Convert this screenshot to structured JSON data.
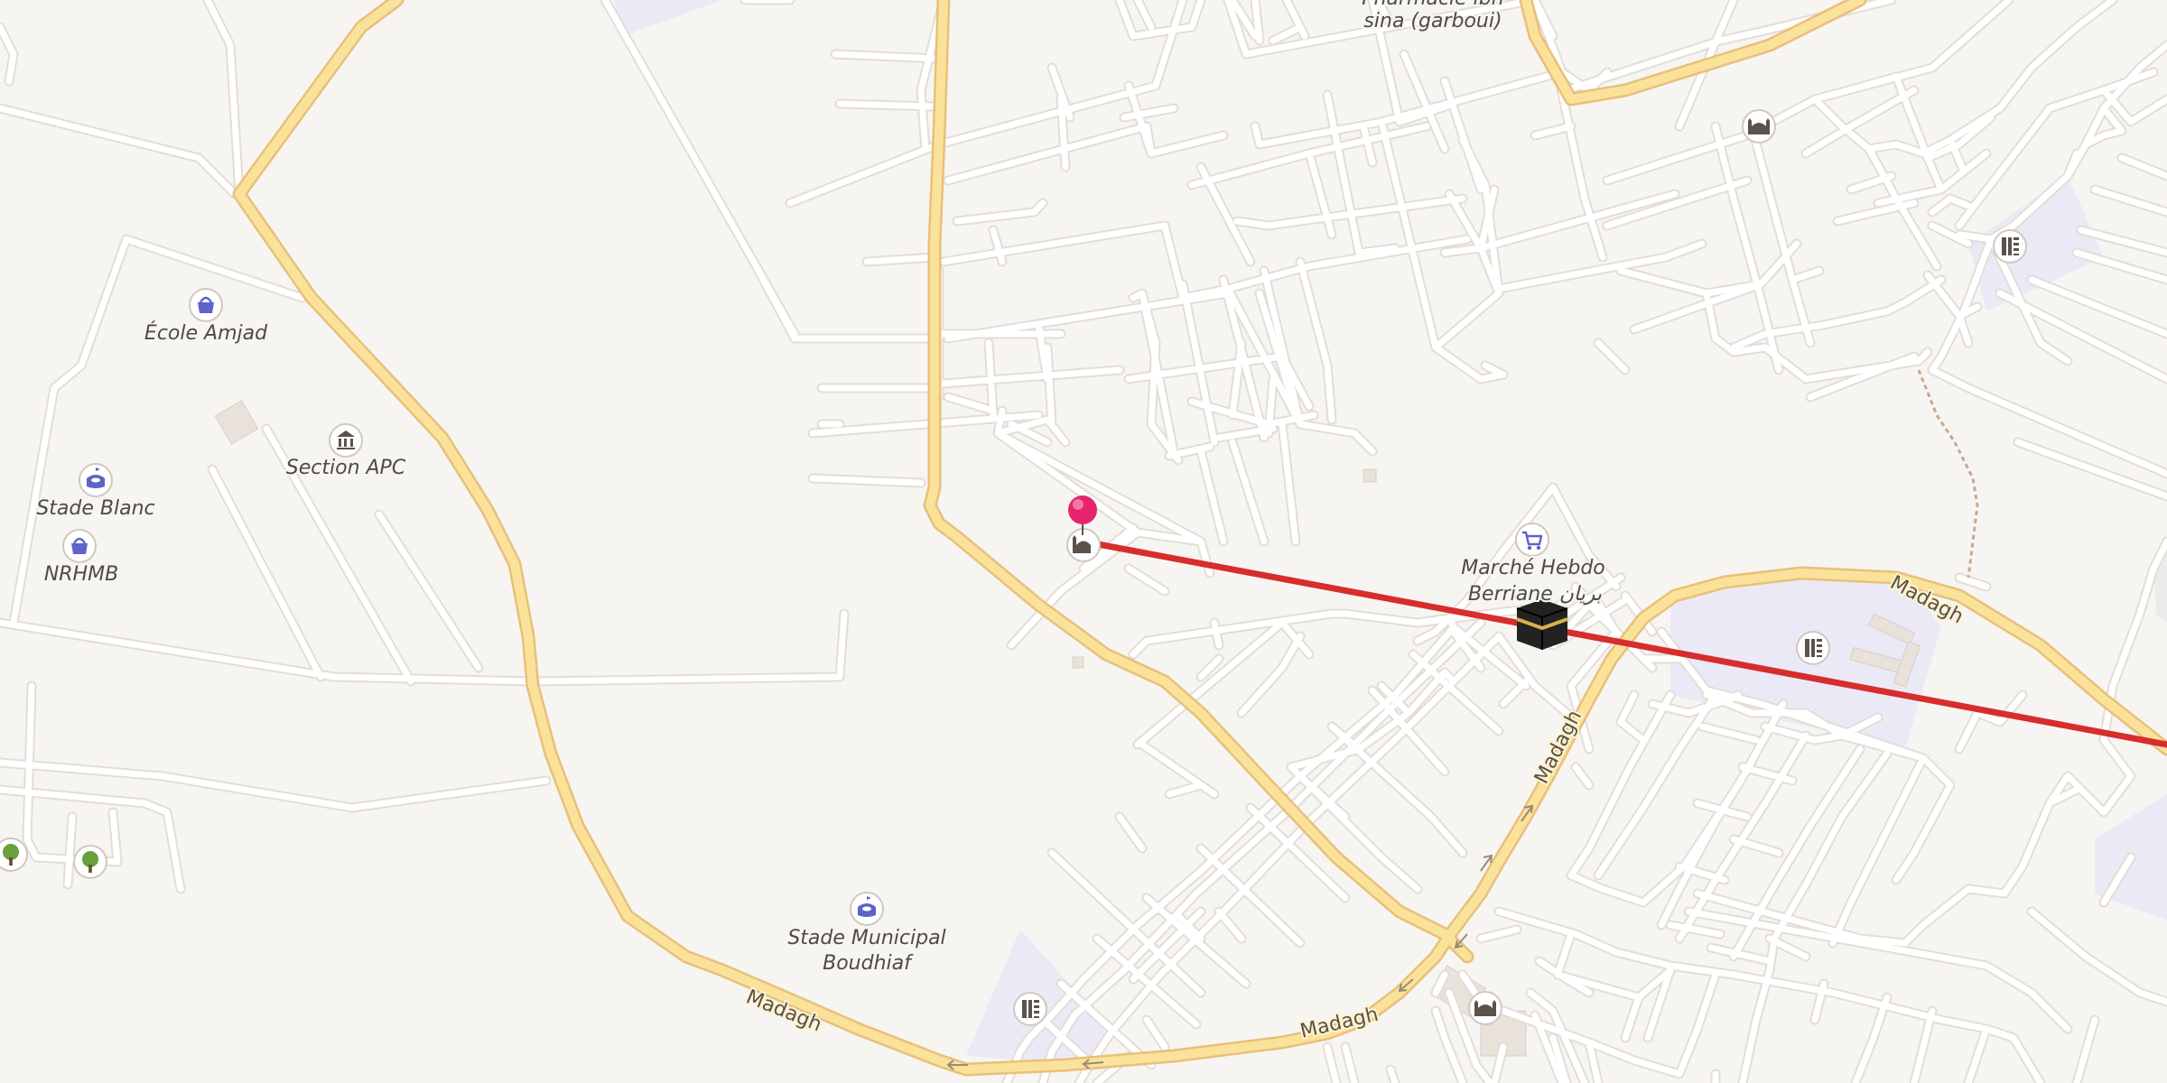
{
  "map": {
    "colors": {
      "background": "#f7f5f2",
      "minor_road": "#ffffff",
      "minor_road_casing": "#e3ddd6",
      "primary_road": "#fbe29a",
      "primary_road_casing": "#e8c07a",
      "landuse_school": "#ece9f7",
      "route_line": "#d62d2d",
      "pin": "#e5246b"
    },
    "road_labels": {
      "madagh_1": "Madagh",
      "madagh_2": "Madagh",
      "madagh_3": "Madagh",
      "madagh_4": "Madagh"
    },
    "poi": {
      "ecole_amjad": "École Amjad",
      "section_apc": "Section APC",
      "stade_blanc": "Stade Blanc",
      "nrhmb": "NRHMB",
      "stade_municipal_line1": "Stade Municipal",
      "stade_municipal_line2": "Boudhiaf",
      "marche_line1": "Marché Hebdo",
      "marche_line2": "Berriane بريان",
      "pharmacie_line1": "Pharmacie ibn",
      "pharmacie_line2": "sina (garboui)"
    },
    "icons": {
      "ecole_amjad": "shopping-basket-icon",
      "section_apc": "town-hall-icon",
      "stade_blanc": "stadium-icon",
      "nrhmb": "shopping-basket-icon",
      "stade_municipal": "stadium-icon",
      "marche": "shopping-cart-icon",
      "mosque_pin": "mosque-icon",
      "mosque_top": "mosque-icon",
      "mosque_bottom": "mosque-icon",
      "school_1": "school-icon",
      "school_2": "school-icon",
      "school_3": "school-icon",
      "kaaba": "kaaba-icon",
      "tree_1": "tree-icon",
      "tree_2": "tree-icon"
    }
  }
}
